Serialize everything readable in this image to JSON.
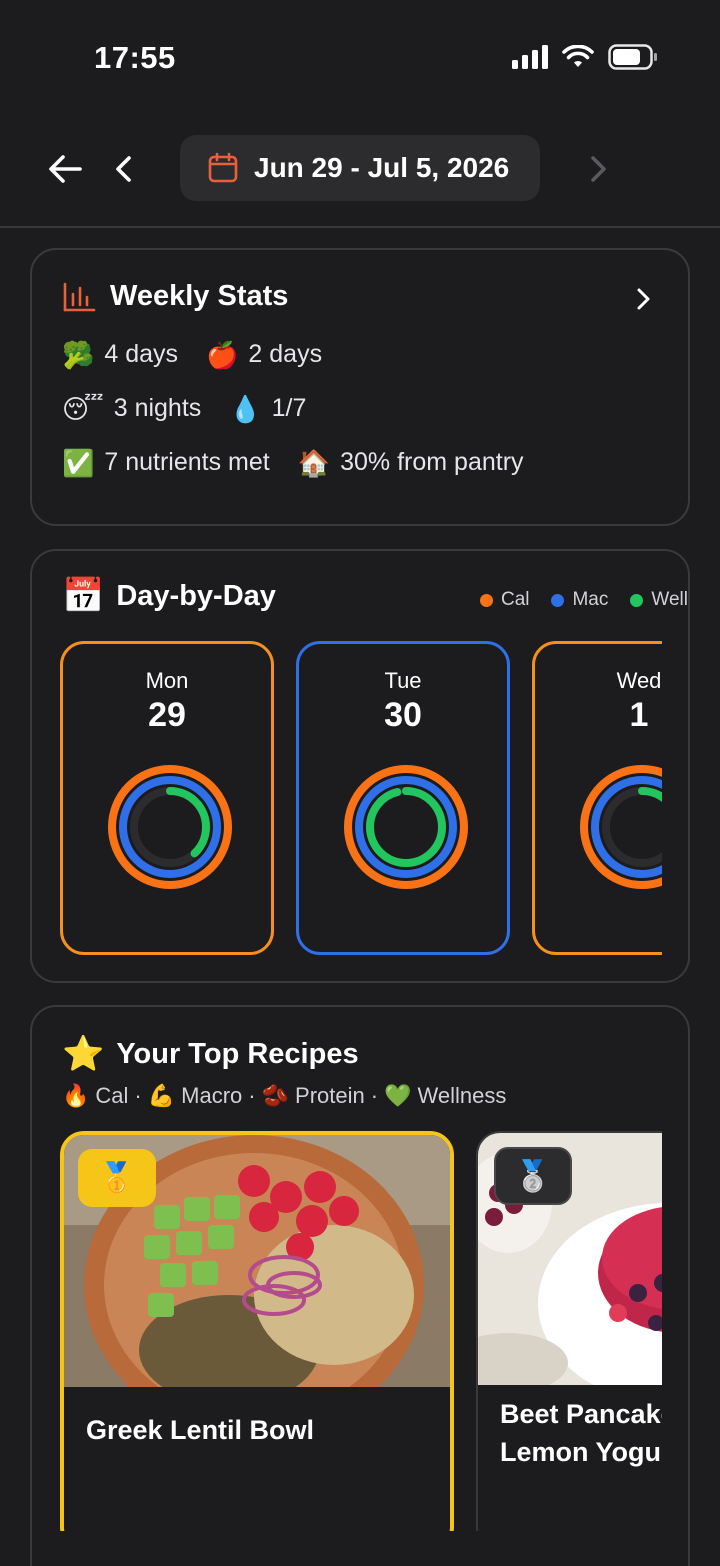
{
  "status": {
    "time": "17:55"
  },
  "header": {
    "date_range": "Jun 29 - Jul 5, 2026"
  },
  "weekly_stats": {
    "title": "Weekly Stats",
    "items": [
      {
        "icon": "🥦",
        "text": "4 days"
      },
      {
        "icon": "🍎",
        "text": "2 days"
      },
      {
        "icon": "😴",
        "text": "3 nights"
      },
      {
        "icon": "💧",
        "text": "1/7"
      },
      {
        "icon": "✅",
        "text": "7 nutrients met"
      },
      {
        "icon": "🏠",
        "text": "30% from pantry"
      }
    ]
  },
  "day_by_day": {
    "title": "Day-by-Day",
    "icon": "📅",
    "legend": [
      {
        "label": "Cal",
        "color": "#f97316"
      },
      {
        "label": "Mac",
        "color": "#2f6fe8"
      },
      {
        "label": "Well",
        "color": "#22c55e"
      }
    ],
    "days": [
      {
        "name": "Mon",
        "num": "29",
        "border": "#f5901e",
        "cal": 1.0,
        "mac": 1.0,
        "well": 0.38
      },
      {
        "name": "Tue",
        "num": "30",
        "border": "#2f6fe8",
        "cal": 1.0,
        "mac": 1.0,
        "well": 0.96
      },
      {
        "name": "Wed",
        "num": "1",
        "border": "#f5901e",
        "cal": 1.0,
        "mac": 1.0,
        "well": 0.3
      }
    ]
  },
  "top_recipes": {
    "title": "Your Top Recipes",
    "icon": "⭐",
    "legend_icons": [
      "🔥",
      "💪",
      "🫘",
      "💚"
    ],
    "legend_labels": [
      "Cal",
      "Macro",
      "Protein",
      "Wellness"
    ],
    "items": [
      {
        "rank_icon": "🥇",
        "name_lines": [
          "Greek Lentil Bowl"
        ]
      },
      {
        "rank_icon": "🥈",
        "name_lines": [
          "Beet Pancakes",
          "Lemon Yogurt"
        ]
      }
    ]
  },
  "colors": {
    "background": "#1c1c1e",
    "card_border": "#3a3a3c",
    "gold": "#f5c518"
  }
}
